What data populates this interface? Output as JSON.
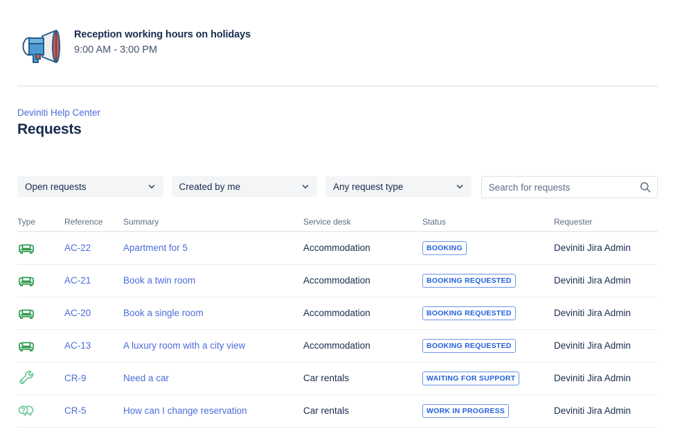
{
  "announcement": {
    "icon": "megaphone-icon",
    "title": "Reception working hours on holidays",
    "subtitle": "9:00 AM - 3:00 PM"
  },
  "breadcrumb": {
    "label": "Deviniti Help Center"
  },
  "page": {
    "title": "Requests"
  },
  "filters": {
    "status_filter": {
      "value": "Open requests",
      "icon": "chevron-down-icon"
    },
    "creator_filter": {
      "value": "Created by me",
      "icon": "chevron-down-icon"
    },
    "request_type_filter": {
      "value": "Any request type",
      "icon": "chevron-down-icon"
    },
    "search": {
      "value": "",
      "placeholder": "Search for requests",
      "icon": "search-icon"
    }
  },
  "table": {
    "columns": [
      "Type",
      "Reference",
      "Summary",
      "Service desk",
      "Status",
      "Requester"
    ],
    "rows": [
      {
        "type_icon": "armchair-icon",
        "reference": "AC-22",
        "summary": "Apartment for 5",
        "service_desk": "Accommodation",
        "status": "BOOKING",
        "requester": "Deviniti Jira Admin"
      },
      {
        "type_icon": "armchair-icon",
        "reference": "AC-21",
        "summary": "Book a twin room",
        "service_desk": "Accommodation",
        "status": "BOOKING REQUESTED",
        "requester": "Deviniti Jira Admin"
      },
      {
        "type_icon": "armchair-icon",
        "reference": "AC-20",
        "summary": "Book a single room",
        "service_desk": "Accommodation",
        "status": "BOOKING REQUESTED",
        "requester": "Deviniti Jira Admin"
      },
      {
        "type_icon": "armchair-icon",
        "reference": "AC-13",
        "summary": "A luxury room with a city view",
        "service_desk": "Accommodation",
        "status": "BOOKING REQUESTED",
        "requester": "Deviniti Jira Admin"
      },
      {
        "type_icon": "wrench-icon",
        "reference": "CR-9",
        "summary": "Need a car",
        "service_desk": "Car rentals",
        "status": "WAITING FOR SUPPORT",
        "requester": "Deviniti Jira Admin"
      },
      {
        "type_icon": "question-bubble-icon",
        "reference": "CR-5",
        "summary": "How can I change reservation",
        "service_desk": "Car rentals",
        "status": "WORK IN PROGRESS",
        "requester": "Deviniti Jira Admin"
      }
    ]
  },
  "colors": {
    "link": "#4C6CD9",
    "text": "#172B4D",
    "muted": "#5E6C84",
    "badge_border": "#6C93E8",
    "badge_text": "#2360D9",
    "divider": "#EBECF0",
    "field_bg": "#F4F5F7",
    "icon_green": "#2E9B4E",
    "icon_teal": "#6FC79B",
    "megaphone_blue": "#3D87C9",
    "megaphone_red": "#E8503A"
  }
}
